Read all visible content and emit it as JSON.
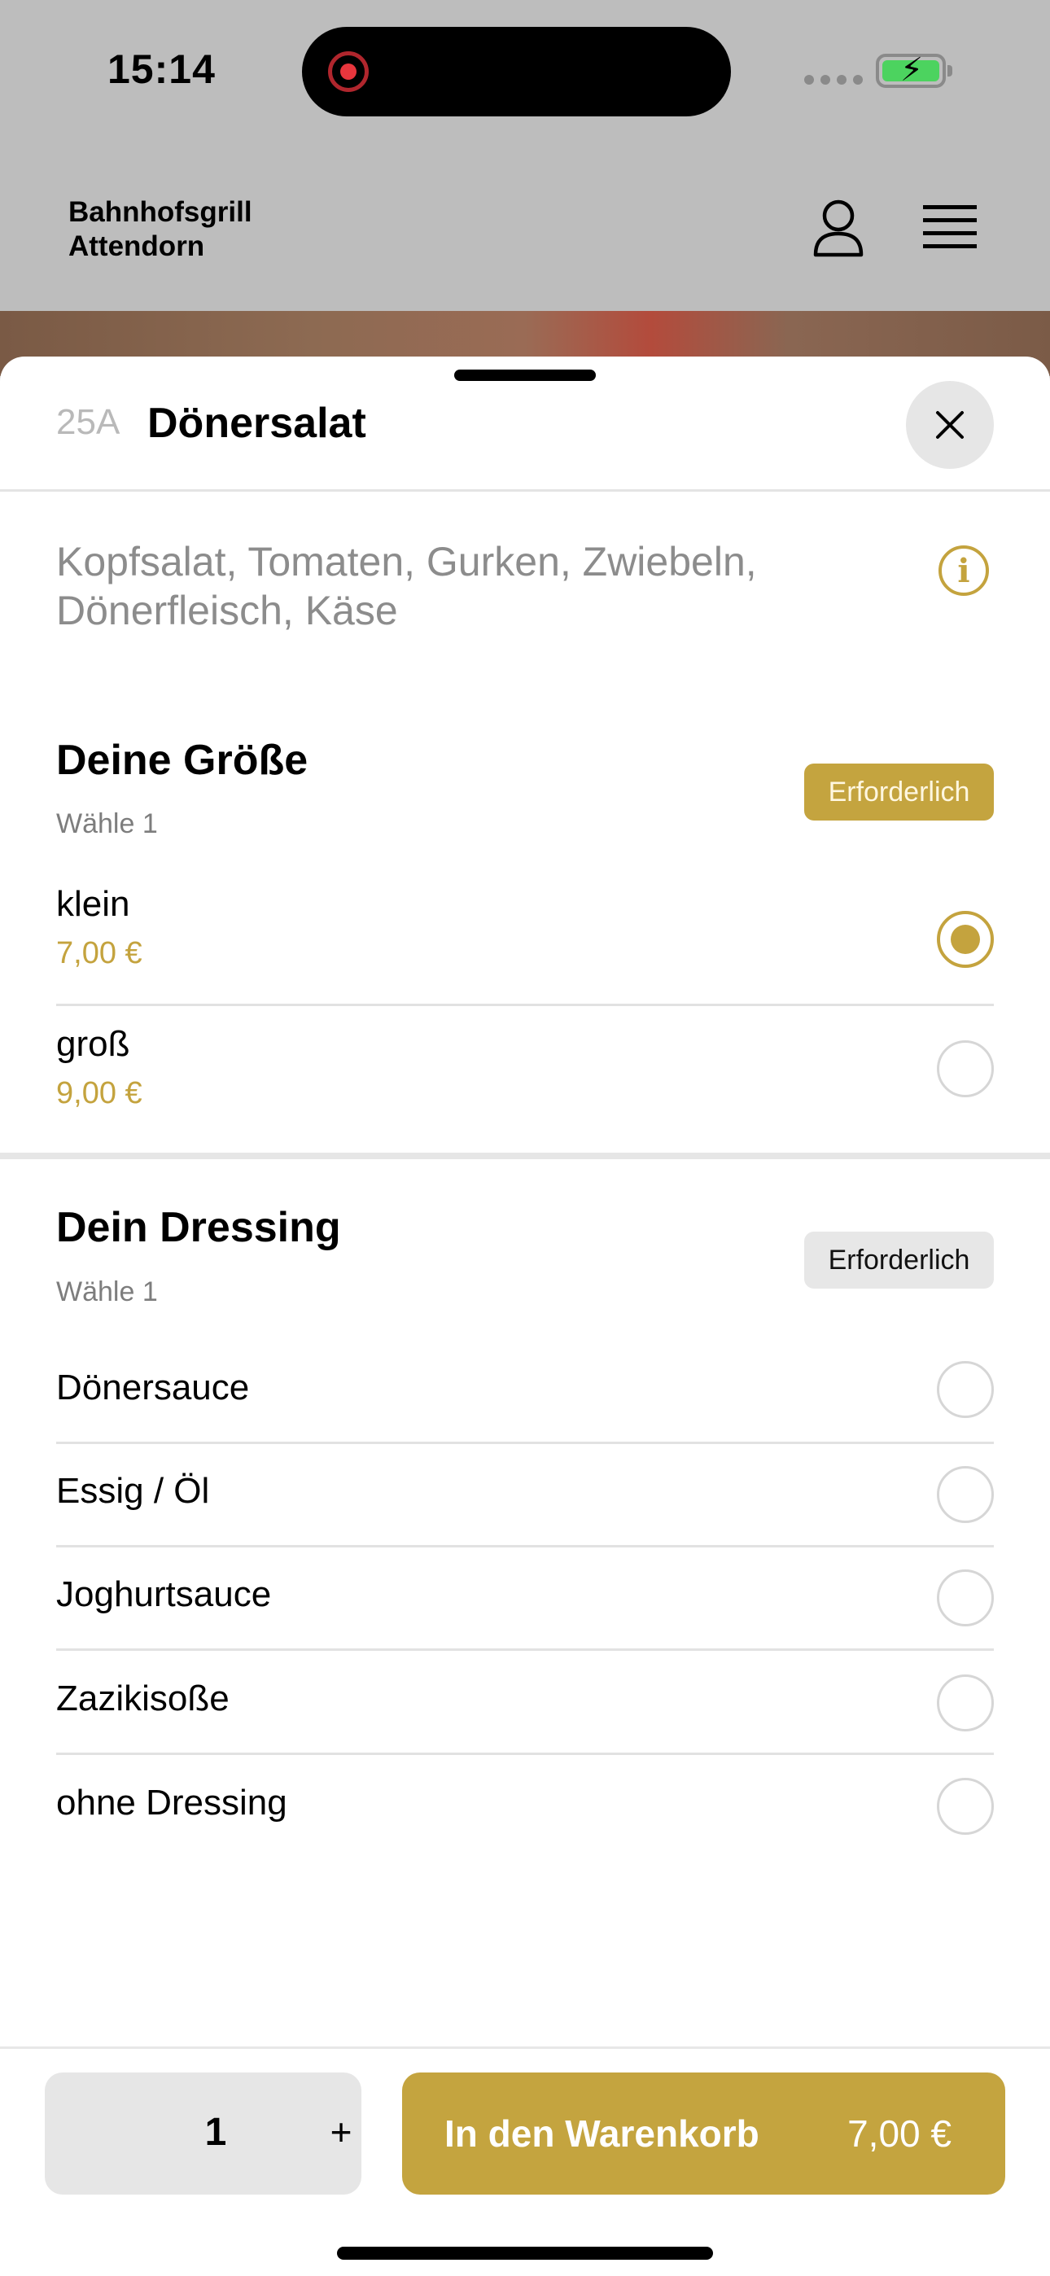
{
  "status_bar": {
    "time": "15:14"
  },
  "header": {
    "brand_line1": "Bahnhofsgrill",
    "brand_line2": "Attendorn",
    "user_icon": "person-icon",
    "menu_icon": "hamburger-menu-icon"
  },
  "product": {
    "number": "25A",
    "title": "Dönersalat",
    "description": "Kopfsalat, Tomaten, Gurken, Zwiebeln, Dönerfleisch, Käse"
  },
  "groups": [
    {
      "title": "Deine Größe",
      "subtitle": "Wähle 1",
      "badge": "Erforderlich",
      "badge_state": "active",
      "options": [
        {
          "label": "klein",
          "price": "7,00 €",
          "selected": true
        },
        {
          "label": "groß",
          "price": "9,00 €",
          "selected": false
        }
      ]
    },
    {
      "title": "Dein Dressing",
      "subtitle": "Wähle 1",
      "badge": "Erforderlich",
      "badge_state": "inactive",
      "options": [
        {
          "label": "Dönersauce",
          "selected": false
        },
        {
          "label": "Essig / Öl",
          "selected": false
        },
        {
          "label": "Joghurtsauce",
          "selected": false
        },
        {
          "label": "Zazikisoße",
          "selected": false
        },
        {
          "label": "ohne Dressing",
          "selected": false
        }
      ]
    }
  ],
  "footer": {
    "quantity": "1",
    "plus_label": "+",
    "add_to_cart_label": "In den Warenkorb",
    "total_price": "7,00 €"
  },
  "colors": {
    "accent": "#c4a43f",
    "background_dim": "#bdbdbd",
    "text_muted": "#8c8c8c"
  }
}
